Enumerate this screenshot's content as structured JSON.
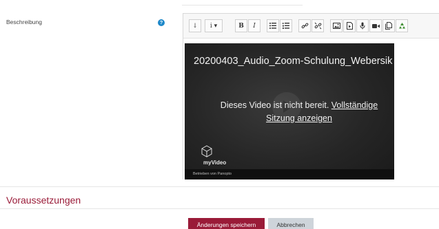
{
  "field": {
    "label": "Beschreibung",
    "help_icon_glyph": "?",
    "help_icon": "question-circle-icon"
  },
  "toolbar": {
    "buttons": [
      {
        "name": "toggle-toolbar-button",
        "glyph": "↓",
        "icon": "arrow-down-icon"
      },
      {
        "name": "paragraph-style-button",
        "glyph": "i ▾",
        "icon": "info-dropdown-icon"
      },
      {
        "name": "bold-button",
        "glyph": "B",
        "icon": "bold-icon"
      },
      {
        "name": "italic-button",
        "glyph": "I",
        "icon": "italic-icon"
      },
      {
        "name": "unordered-list-button",
        "icon": "list-ul-icon"
      },
      {
        "name": "ordered-list-button",
        "icon": "list-ol-icon"
      },
      {
        "name": "link-button",
        "icon": "link-icon"
      },
      {
        "name": "unlink-button",
        "icon": "unlink-icon"
      },
      {
        "name": "image-button",
        "icon": "image-icon"
      },
      {
        "name": "media-button",
        "icon": "file-media-icon"
      },
      {
        "name": "record-audio-button",
        "icon": "microphone-icon"
      },
      {
        "name": "record-video-button",
        "icon": "video-camera-icon"
      },
      {
        "name": "manage-files-button",
        "icon": "files-icon"
      },
      {
        "name": "accessibility-checker-button",
        "icon": "recycle-icon"
      }
    ]
  },
  "video": {
    "title": "20200403_Audio_Zoom-Schulung_Webersik",
    "message_prefix": "Dieses Video ist nicht bereit.",
    "link_line1": "Vollständige",
    "link_line2": "Sitzung anzeigen",
    "brand": "myVideo",
    "powered_by": "Betrieben von Panopto"
  },
  "section": {
    "title": "Voraussetzungen"
  },
  "actions": {
    "save_label": "Änderungen speichern",
    "cancel_label": "Abbrechen"
  },
  "colors": {
    "accent": "#9a1b38",
    "help": "#1e88c9",
    "cancel_bg": "#ced4da"
  }
}
